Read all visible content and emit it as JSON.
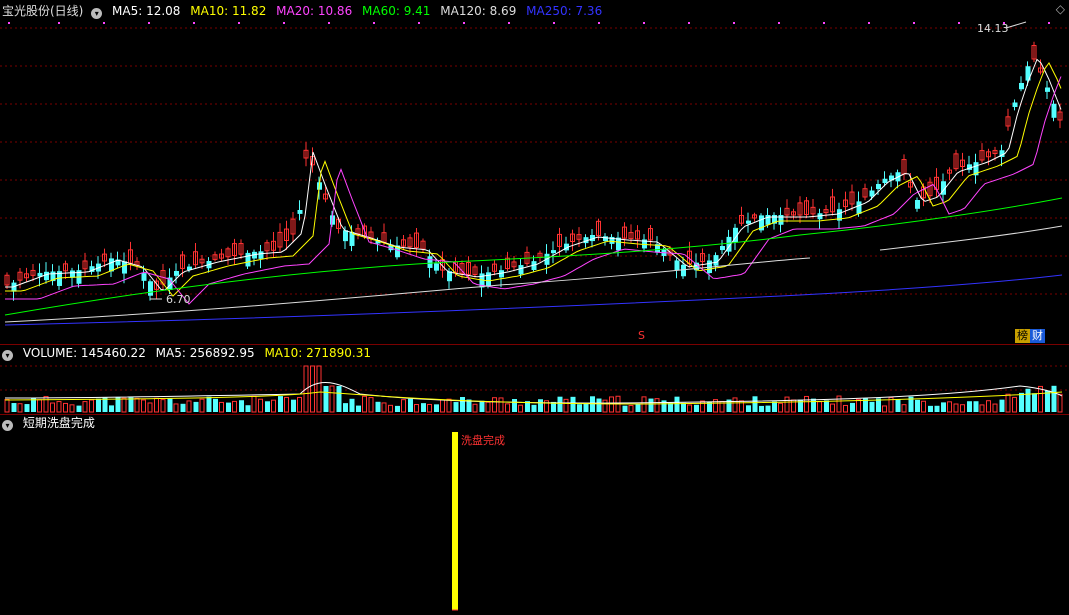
{
  "main": {
    "title": "宝光股份(日线)",
    "ma": [
      {
        "label": "MA5: 12.08",
        "color": "#ffffff"
      },
      {
        "label": "MA10: 11.82",
        "color": "#ffff00"
      },
      {
        "label": "MA20: 10.86",
        "color": "#ff44ff"
      },
      {
        "label": "MA60: 9.41",
        "color": "#00ff00"
      },
      {
        "label": "MA120: 8.69",
        "color": "#dddddd"
      },
      {
        "label": "MA250: 7.36",
        "color": "#3333ff"
      }
    ],
    "high_label": "14.13",
    "low_label": "6.70",
    "marker_s": "S",
    "tag_bang": "榜",
    "tag_cai": "财"
  },
  "volume": {
    "title": "VOLUME: 145460.22",
    "ma5": "MA5: 256892.95",
    "ma10": "MA10: 271890.31"
  },
  "indicator": {
    "title": "短期洗盘完成",
    "signal_label": "洗盘完成"
  },
  "colors": {
    "up": "#ff3232",
    "down": "#54ffff",
    "grid": "#7a0000",
    "signal": "#ffff00"
  }
}
